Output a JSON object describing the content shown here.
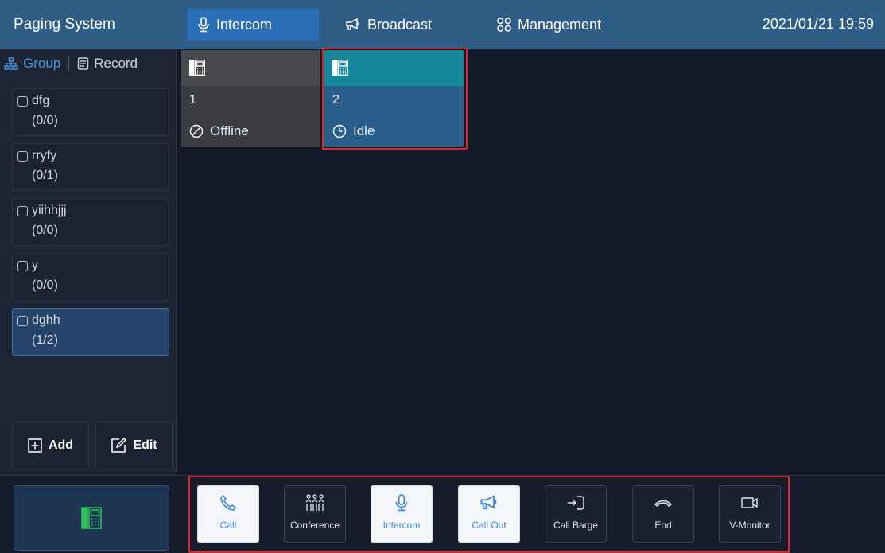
{
  "app": {
    "title": "Paging System",
    "datetime": "2021/01/21 19:59"
  },
  "nav": {
    "tabs": [
      {
        "label": "Intercom",
        "icon": "mic-icon",
        "active": true
      },
      {
        "label": "Broadcast",
        "icon": "megaphone-icon",
        "active": false
      },
      {
        "label": "Management",
        "icon": "grid-icon",
        "active": false
      }
    ]
  },
  "sidebar": {
    "tabs": [
      {
        "label": "Group",
        "icon": "hierarchy-icon",
        "active": true
      },
      {
        "label": "Record",
        "icon": "record-icon",
        "active": false
      }
    ],
    "groups": [
      {
        "name": "dfg",
        "count": "(0/0)",
        "selected": false
      },
      {
        "name": "rryfy",
        "count": "(0/1)",
        "selected": false
      },
      {
        "name": "yiihhjjj",
        "count": "(0/0)",
        "selected": false
      },
      {
        "name": "y",
        "count": "(0/0)",
        "selected": false
      },
      {
        "name": "dghh",
        "count": "(1/2)",
        "selected": true
      }
    ],
    "add_label": "Add",
    "edit_label": "Edit"
  },
  "devices": [
    {
      "number": "1",
      "status": "Offline",
      "status_icon": "offline-icon"
    },
    {
      "number": "2",
      "status": "Idle",
      "status_icon": "clock-icon"
    }
  ],
  "actions": [
    {
      "label": "Call",
      "icon": "phone-icon",
      "style": "light"
    },
    {
      "label": "Conference",
      "icon": "conference-icon",
      "style": "dark"
    },
    {
      "label": "Intercom",
      "icon": "mic-icon",
      "style": "light"
    },
    {
      "label": "Call Out",
      "icon": "megaphone-icon",
      "style": "light"
    },
    {
      "label": "Call Barge",
      "icon": "barge-icon",
      "style": "dark"
    },
    {
      "label": "End",
      "icon": "hangup-icon",
      "style": "dark"
    },
    {
      "label": "V-Monitor",
      "icon": "camera-icon",
      "style": "dark"
    }
  ],
  "colors": {
    "topbar": "#2f5d86",
    "active_tab": "#2a6fb8",
    "highlight_red": "#e0262b",
    "idle_card": "#2b5f8b",
    "idle_card_head": "#16869a",
    "offline_card": "#3b3d42",
    "accent_green": "#2fbf5f"
  }
}
